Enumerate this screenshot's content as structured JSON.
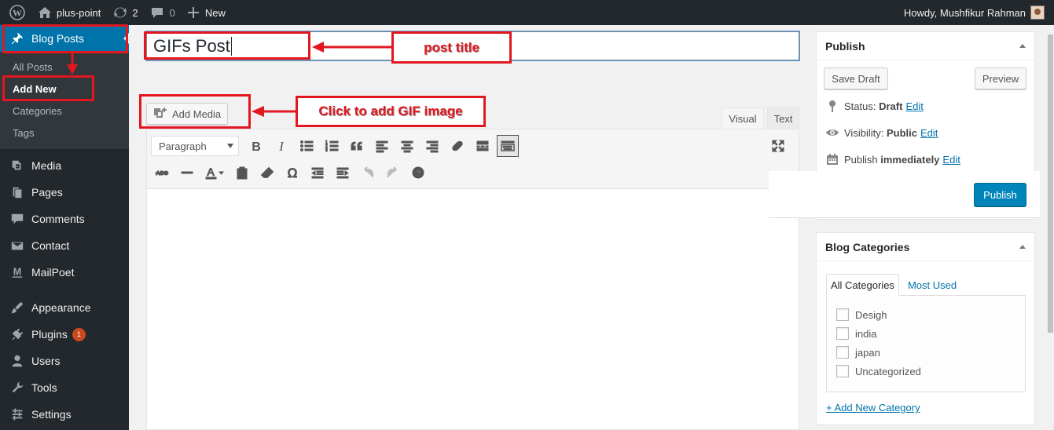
{
  "admin_bar": {
    "site_name": "plus-point",
    "updates_count": "2",
    "comments_count": "0",
    "new_label": "New",
    "greeting": "Howdy, Mushfikur Rahman"
  },
  "sidebar": {
    "blog_posts": "Blog Posts",
    "submenu": [
      "All Posts",
      "Add New",
      "Categories",
      "Tags"
    ],
    "items": [
      "Media",
      "Pages",
      "Comments",
      "Contact",
      "MailPoet",
      "Appearance",
      "Plugins",
      "Users",
      "Tools",
      "Settings"
    ],
    "plugins_badge": "1"
  },
  "editor": {
    "title_value": "GIFs Post",
    "add_media_label": "Add Media",
    "tab_visual": "Visual",
    "tab_text": "Text",
    "format_select": "Paragraph"
  },
  "publish_box": {
    "title": "Publish",
    "save_draft": "Save Draft",
    "preview": "Preview",
    "status_label": "Status:",
    "status_value": "Draft",
    "visibility_label": "Visibility:",
    "visibility_value": "Public",
    "publish_label": "Publish",
    "publish_value": "immediately",
    "edit_label": "Edit",
    "publish_button": "Publish"
  },
  "categories_box": {
    "title": "Blog Categories",
    "tab_all": "All Categories",
    "tab_most_used": "Most Used",
    "categories": [
      "Desigh",
      "india",
      "japan",
      "Uncategorized"
    ],
    "add_new": "+ Add New Category"
  },
  "annotations": {
    "post_title": "post title",
    "add_gif": "Click to add GIF image"
  },
  "colors": {
    "admin_dark": "#23282d",
    "accent": "#0073aa",
    "primary_button": "#0085ba",
    "annotation_red": "#e3171f"
  }
}
